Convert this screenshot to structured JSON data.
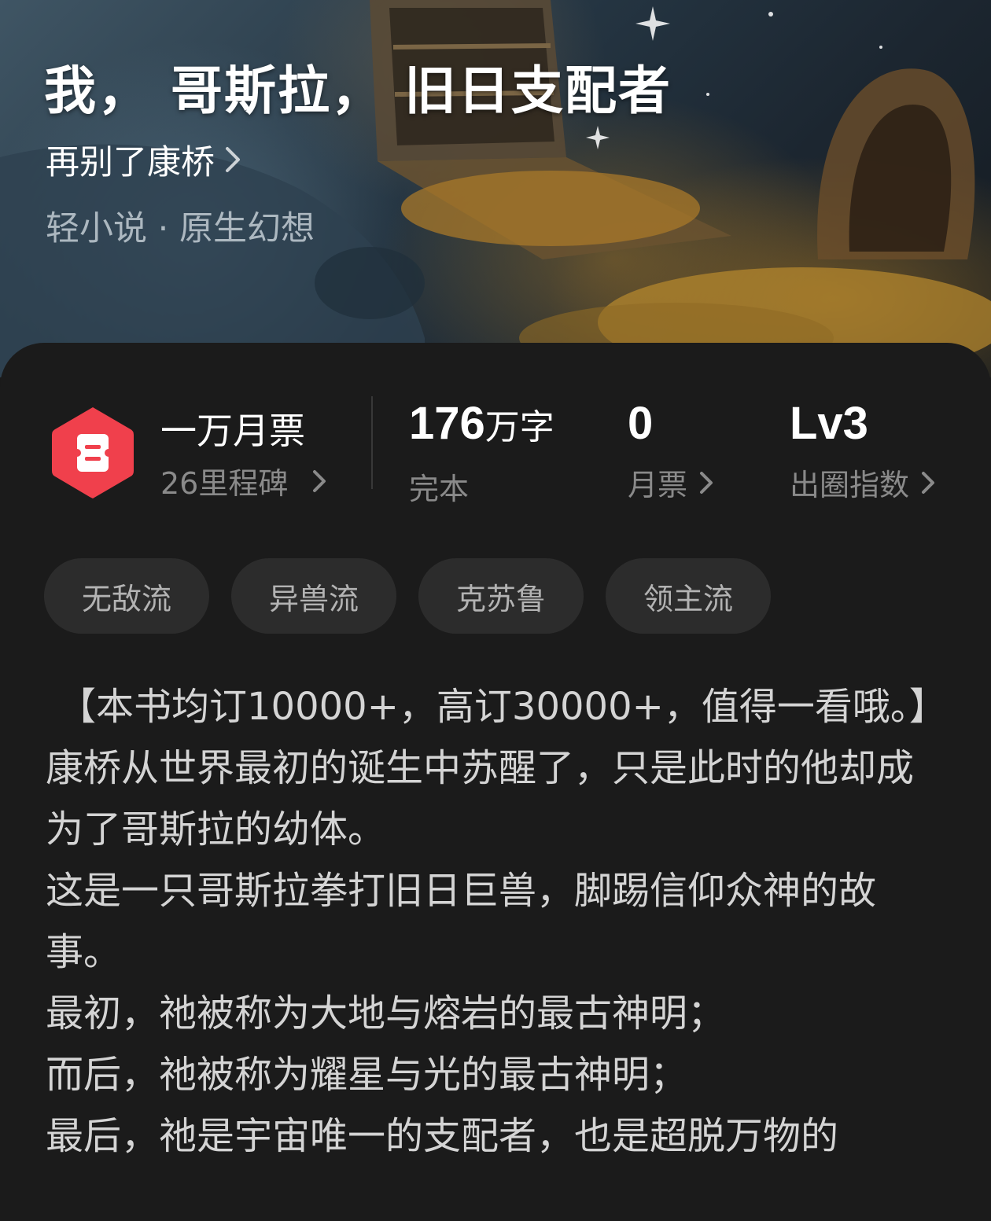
{
  "book": {
    "title": "我，  哥斯拉，  旧日支配者",
    "author": "再别了康桥",
    "genre": "轻小说 · 原生幻想"
  },
  "milestone": {
    "title": "一万月票",
    "subtitle": "26里程碑",
    "icon": "ticket-badge-icon",
    "color": "#f0404c"
  },
  "stats": {
    "words": {
      "value": "176",
      "unit": "万字",
      "label": "完本"
    },
    "monthly_votes": {
      "value": "0",
      "label": "月票"
    },
    "breakout": {
      "value": "Lv3",
      "label": "出圈指数"
    }
  },
  "tags": [
    "无敌流",
    "异兽流",
    "克苏鲁",
    "领主流"
  ],
  "description": [
    "【本书均订10000+，高订30000+，值得一看哦。】",
    "康桥从世界最初的诞生中苏醒了，只是此时的他却成为了哥斯拉的幼体。",
    "这是一只哥斯拉拳打旧日巨兽，脚踢信仰众神的故事。",
    "最初，祂被称为大地与熔岩的最古神明；",
    "而后，祂被称为耀星与光的最古神明；",
    "最后，祂是宇宙唯一的支配者，也是超脱万物的"
  ]
}
